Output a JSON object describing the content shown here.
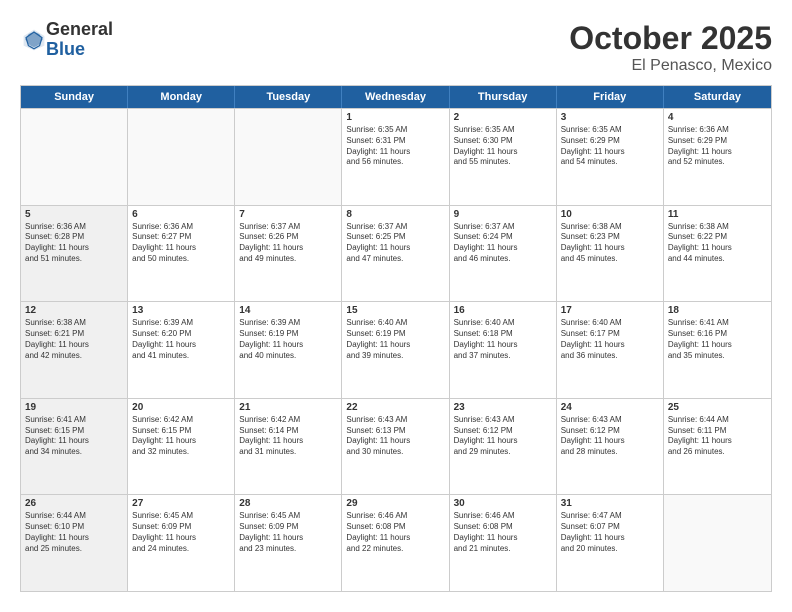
{
  "logo": {
    "general": "General",
    "blue": "Blue"
  },
  "title": "October 2025",
  "subtitle": "El Penasco, Mexico",
  "header_days": [
    "Sunday",
    "Monday",
    "Tuesday",
    "Wednesday",
    "Thursday",
    "Friday",
    "Saturday"
  ],
  "rows": [
    [
      {
        "day": "",
        "lines": [],
        "empty": true
      },
      {
        "day": "",
        "lines": [],
        "empty": true
      },
      {
        "day": "",
        "lines": [],
        "empty": true
      },
      {
        "day": "1",
        "lines": [
          "Sunrise: 6:35 AM",
          "Sunset: 6:31 PM",
          "Daylight: 11 hours",
          "and 56 minutes."
        ]
      },
      {
        "day": "2",
        "lines": [
          "Sunrise: 6:35 AM",
          "Sunset: 6:30 PM",
          "Daylight: 11 hours",
          "and 55 minutes."
        ]
      },
      {
        "day": "3",
        "lines": [
          "Sunrise: 6:35 AM",
          "Sunset: 6:29 PM",
          "Daylight: 11 hours",
          "and 54 minutes."
        ]
      },
      {
        "day": "4",
        "lines": [
          "Sunrise: 6:36 AM",
          "Sunset: 6:29 PM",
          "Daylight: 11 hours",
          "and 52 minutes."
        ]
      }
    ],
    [
      {
        "day": "5",
        "lines": [
          "Sunrise: 6:36 AM",
          "Sunset: 6:28 PM",
          "Daylight: 11 hours",
          "and 51 minutes."
        ]
      },
      {
        "day": "6",
        "lines": [
          "Sunrise: 6:36 AM",
          "Sunset: 6:27 PM",
          "Daylight: 11 hours",
          "and 50 minutes."
        ]
      },
      {
        "day": "7",
        "lines": [
          "Sunrise: 6:37 AM",
          "Sunset: 6:26 PM",
          "Daylight: 11 hours",
          "and 49 minutes."
        ]
      },
      {
        "day": "8",
        "lines": [
          "Sunrise: 6:37 AM",
          "Sunset: 6:25 PM",
          "Daylight: 11 hours",
          "and 47 minutes."
        ]
      },
      {
        "day": "9",
        "lines": [
          "Sunrise: 6:37 AM",
          "Sunset: 6:24 PM",
          "Daylight: 11 hours",
          "and 46 minutes."
        ]
      },
      {
        "day": "10",
        "lines": [
          "Sunrise: 6:38 AM",
          "Sunset: 6:23 PM",
          "Daylight: 11 hours",
          "and 45 minutes."
        ]
      },
      {
        "day": "11",
        "lines": [
          "Sunrise: 6:38 AM",
          "Sunset: 6:22 PM",
          "Daylight: 11 hours",
          "and 44 minutes."
        ]
      }
    ],
    [
      {
        "day": "12",
        "lines": [
          "Sunrise: 6:38 AM",
          "Sunset: 6:21 PM",
          "Daylight: 11 hours",
          "and 42 minutes."
        ]
      },
      {
        "day": "13",
        "lines": [
          "Sunrise: 6:39 AM",
          "Sunset: 6:20 PM",
          "Daylight: 11 hours",
          "and 41 minutes."
        ]
      },
      {
        "day": "14",
        "lines": [
          "Sunrise: 6:39 AM",
          "Sunset: 6:19 PM",
          "Daylight: 11 hours",
          "and 40 minutes."
        ]
      },
      {
        "day": "15",
        "lines": [
          "Sunrise: 6:40 AM",
          "Sunset: 6:19 PM",
          "Daylight: 11 hours",
          "and 39 minutes."
        ]
      },
      {
        "day": "16",
        "lines": [
          "Sunrise: 6:40 AM",
          "Sunset: 6:18 PM",
          "Daylight: 11 hours",
          "and 37 minutes."
        ]
      },
      {
        "day": "17",
        "lines": [
          "Sunrise: 6:40 AM",
          "Sunset: 6:17 PM",
          "Daylight: 11 hours",
          "and 36 minutes."
        ]
      },
      {
        "day": "18",
        "lines": [
          "Sunrise: 6:41 AM",
          "Sunset: 6:16 PM",
          "Daylight: 11 hours",
          "and 35 minutes."
        ]
      }
    ],
    [
      {
        "day": "19",
        "lines": [
          "Sunrise: 6:41 AM",
          "Sunset: 6:15 PM",
          "Daylight: 11 hours",
          "and 34 minutes."
        ]
      },
      {
        "day": "20",
        "lines": [
          "Sunrise: 6:42 AM",
          "Sunset: 6:15 PM",
          "Daylight: 11 hours",
          "and 32 minutes."
        ]
      },
      {
        "day": "21",
        "lines": [
          "Sunrise: 6:42 AM",
          "Sunset: 6:14 PM",
          "Daylight: 11 hours",
          "and 31 minutes."
        ]
      },
      {
        "day": "22",
        "lines": [
          "Sunrise: 6:43 AM",
          "Sunset: 6:13 PM",
          "Daylight: 11 hours",
          "and 30 minutes."
        ]
      },
      {
        "day": "23",
        "lines": [
          "Sunrise: 6:43 AM",
          "Sunset: 6:12 PM",
          "Daylight: 11 hours",
          "and 29 minutes."
        ]
      },
      {
        "day": "24",
        "lines": [
          "Sunrise: 6:43 AM",
          "Sunset: 6:12 PM",
          "Daylight: 11 hours",
          "and 28 minutes."
        ]
      },
      {
        "day": "25",
        "lines": [
          "Sunrise: 6:44 AM",
          "Sunset: 6:11 PM",
          "Daylight: 11 hours",
          "and 26 minutes."
        ]
      }
    ],
    [
      {
        "day": "26",
        "lines": [
          "Sunrise: 6:44 AM",
          "Sunset: 6:10 PM",
          "Daylight: 11 hours",
          "and 25 minutes."
        ]
      },
      {
        "day": "27",
        "lines": [
          "Sunrise: 6:45 AM",
          "Sunset: 6:09 PM",
          "Daylight: 11 hours",
          "and 24 minutes."
        ]
      },
      {
        "day": "28",
        "lines": [
          "Sunrise: 6:45 AM",
          "Sunset: 6:09 PM",
          "Daylight: 11 hours",
          "and 23 minutes."
        ]
      },
      {
        "day": "29",
        "lines": [
          "Sunrise: 6:46 AM",
          "Sunset: 6:08 PM",
          "Daylight: 11 hours",
          "and 22 minutes."
        ]
      },
      {
        "day": "30",
        "lines": [
          "Sunrise: 6:46 AM",
          "Sunset: 6:08 PM",
          "Daylight: 11 hours",
          "and 21 minutes."
        ]
      },
      {
        "day": "31",
        "lines": [
          "Sunrise: 6:47 AM",
          "Sunset: 6:07 PM",
          "Daylight: 11 hours",
          "and 20 minutes."
        ]
      },
      {
        "day": "",
        "lines": [],
        "empty": true
      }
    ]
  ]
}
